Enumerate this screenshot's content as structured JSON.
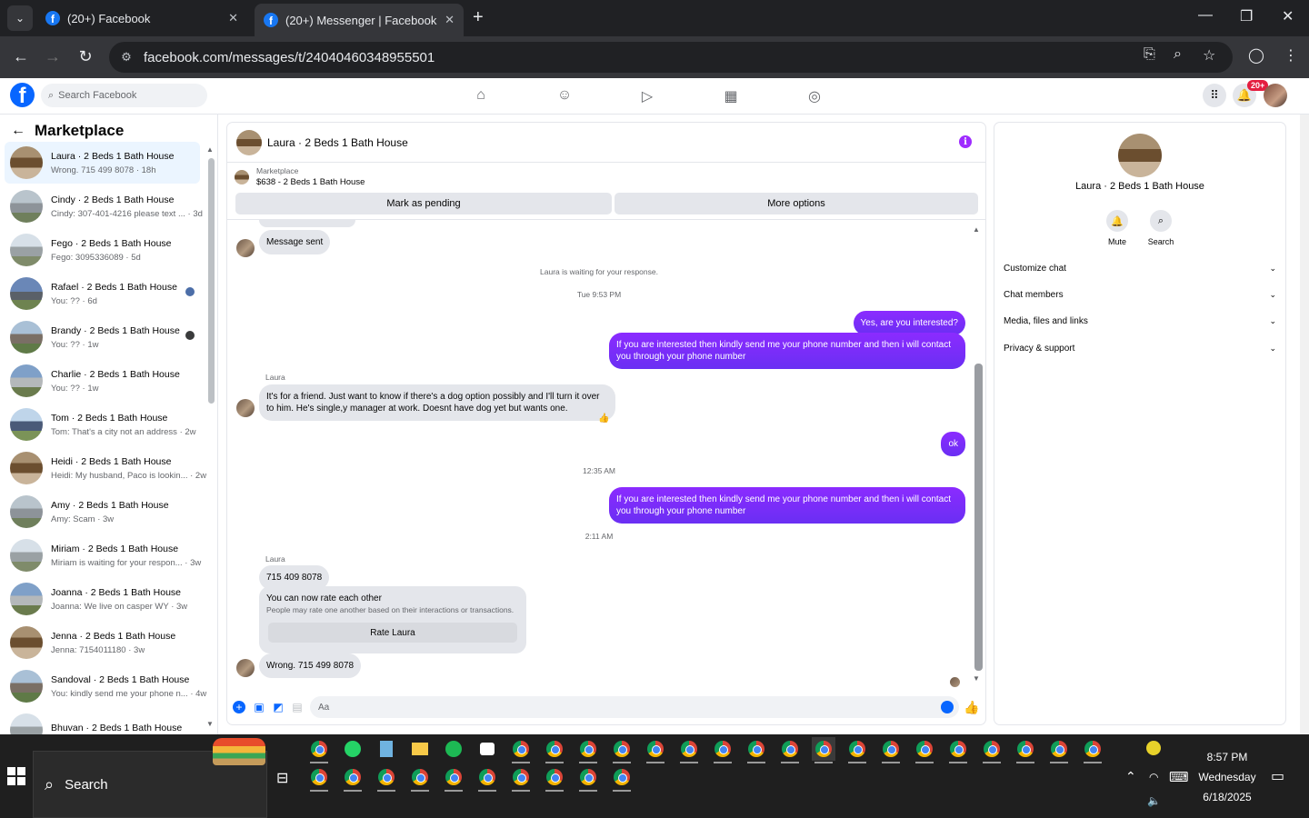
{
  "browser": {
    "tabs": [
      {
        "title": "(20+) Facebook",
        "active": false
      },
      {
        "title": "(20+) Messenger | Facebook",
        "active": true
      }
    ],
    "url": "facebook.com/messages/t/24040460348955501"
  },
  "fb_header": {
    "search_placeholder": "Search Facebook",
    "notification_count": "20+"
  },
  "left_panel": {
    "title": "Marketplace",
    "conversations": [
      {
        "name": "Laura · 2 Beds 1 Bath House",
        "preview": "Wrong. 715 499 8078 · 18h",
        "active": true
      },
      {
        "name": "Cindy · 2 Beds 1 Bath House",
        "preview": "Cindy: 307-401-4216 please text ... · 3d"
      },
      {
        "name": "Fego · 2 Beds 1 Bath House",
        "preview": "Fego: 3095336089 · 5d"
      },
      {
        "name": "Rafael · 2 Beds 1 Bath House",
        "preview": "You: ?? · 6d"
      },
      {
        "name": "Brandy · 2 Beds 1 Bath House",
        "preview": "You: ?? · 1w"
      },
      {
        "name": "Charlie · 2 Beds 1 Bath House",
        "preview": "You: ?? · 1w"
      },
      {
        "name": "Tom · 2 Beds 1 Bath House",
        "preview": "Tom: That's a city not an address · 2w"
      },
      {
        "name": "Heidi · 2 Beds 1 Bath House",
        "preview": "Heidi: My husband, Paco is lookin... · 2w"
      },
      {
        "name": "Amy · 2 Beds 1 Bath House",
        "preview": "Amy: Scam · 3w"
      },
      {
        "name": "Miriam · 2 Beds 1 Bath House",
        "preview": "Miriam is waiting for your respon... · 3w"
      },
      {
        "name": "Joanna · 2 Beds 1 Bath House",
        "preview": "Joanna: We live on casper WY · 3w"
      },
      {
        "name": "Jenna · 2 Beds 1 Bath House",
        "preview": "Jenna: 7154011180 · 3w"
      },
      {
        "name": "Sandoval · 2 Beds 1 Bath House",
        "preview": "You: kindly send me your phone n... · 4w"
      },
      {
        "name": "Bhuvan · 2 Beds 1 Bath House",
        "preview": ""
      }
    ]
  },
  "chat": {
    "title": "Laura · 2 Beds 1 Bath House",
    "marketplace_label": "Marketplace",
    "listing": "$638 - 2 Beds 1 Bath House",
    "mark_pending": "Mark as pending",
    "more_options": "More options",
    "messages": {
      "sent_notice": "Message sent",
      "waiting": "Laura is waiting for your response.",
      "time1": "Tue 9:53 PM",
      "out1": "Yes, are you interested?",
      "out2": "If you are interested then kindly send me your phone number and then i will contact you through your phone number",
      "sender": "Laura",
      "in1": "It's for a friend. Just want to know if there's a dog option possibly and I'll turn it over to him. He's single,y manager at work. Doesnt have dog yet but wants one.",
      "reaction": "👍",
      "out3": "ok",
      "time2": "12:35 AM",
      "out4": "If you are interested then kindly send me your phone number and then i will contact you through your phone number",
      "time3": "2:11 AM",
      "in2": "715 409 8078",
      "rate_title": "You can now rate each other",
      "rate_sub": "People may rate one another based on their interactions or transactions.",
      "rate_btn": "Rate Laura",
      "in3": "Wrong. 715 499 8078"
    },
    "composer_placeholder": "Aa"
  },
  "right_panel": {
    "name": "Laura · 2 Beds 1 Bath House",
    "mute": "Mute",
    "search": "Search",
    "sections": [
      "Customize chat",
      "Chat members",
      "Media, files and links",
      "Privacy & support"
    ]
  },
  "taskbar": {
    "search": "Search",
    "time": "8:57 PM",
    "day": "Wednesday",
    "date": "6/18/2025"
  }
}
